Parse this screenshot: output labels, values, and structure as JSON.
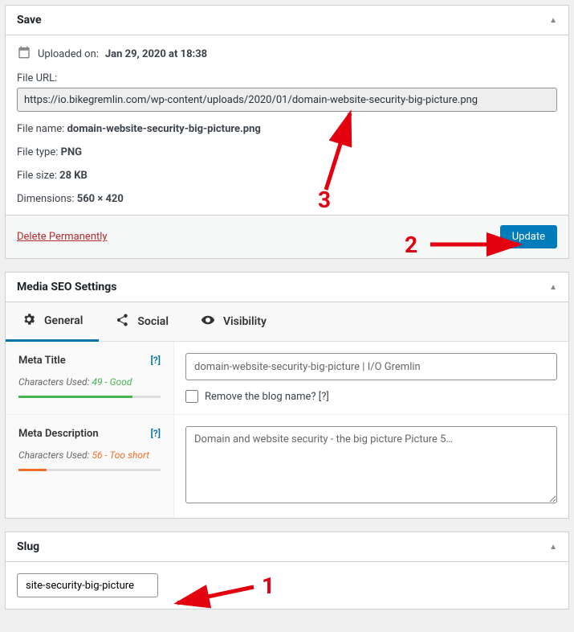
{
  "save": {
    "title": "Save",
    "uploaded_label": "Uploaded on:",
    "uploaded_value": "Jan 29, 2020 at 18:38",
    "file_url_label": "File URL:",
    "file_url": "https://io.bikegremlin.com/wp-content/uploads/2020/01/domain-website-security-big-picture.png",
    "file_name_label": "File name:",
    "file_name": "domain-website-security-big-picture.png",
    "file_type_label": "File type:",
    "file_type": "PNG",
    "file_size_label": "File size:",
    "file_size": "28 KB",
    "dimensions_label": "Dimensions:",
    "dimensions": "560 × 420",
    "delete": "Delete Permanently",
    "update": "Update"
  },
  "seo": {
    "title": "Media SEO Settings",
    "tabs": {
      "general": "General",
      "social": "Social",
      "visibility": "Visibility"
    },
    "meta_title": {
      "label": "Meta Title",
      "help": "[?]",
      "chars_label": "Characters Used: ",
      "chars_val": "49 - Good",
      "value": "domain-website-security-big-picture | I/O Gremlin",
      "remove_blog": "Remove the blog name? [?]"
    },
    "meta_desc": {
      "label": "Meta Description",
      "help": "[?]",
      "chars_label": "Characters Used: ",
      "chars_val": "56 - Too short",
      "value": "Domain and website security - the big picture Picture 5…"
    }
  },
  "slug": {
    "title": "Slug",
    "value": "site-security-big-picture"
  },
  "annotations": {
    "one": "1",
    "two": "2",
    "three": "3"
  }
}
